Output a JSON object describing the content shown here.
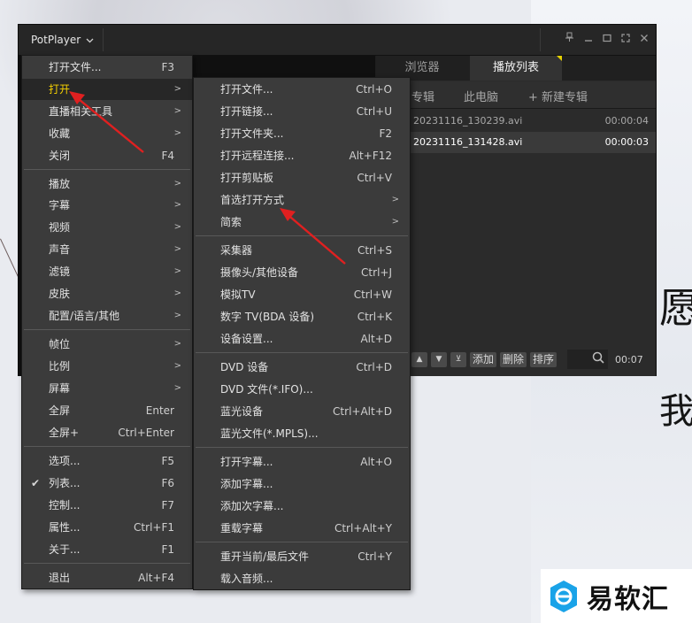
{
  "app": {
    "title": "PotPlayer"
  },
  "titlebar_icons": [
    "pin-icon",
    "minimize-icon",
    "maximize-icon",
    "fullscreen-icon",
    "close-icon"
  ],
  "playlist": {
    "tabs": [
      "浏览器",
      "播放列表"
    ],
    "subtabs": [
      "专辑",
      "此电脑",
      "+ 新建专辑"
    ],
    "items": [
      {
        "name": "20231116_130239.avi",
        "duration": "00:00:04"
      },
      {
        "name": "20231116_131428.avi",
        "duration": "00:00:03"
      }
    ],
    "bottom": {
      "add": "添加",
      "delete": "删除",
      "sort": "排序",
      "time": "00:07"
    }
  },
  "main_menu": {
    "items": [
      {
        "label": "打开文件...",
        "shortcut": "F3"
      },
      {
        "label": "打开",
        "arrow": ">"
      },
      {
        "label": "直播相关工具",
        "arrow": ">"
      },
      {
        "label": "收藏",
        "arrow": ">"
      },
      {
        "label": "关闭",
        "shortcut": "F4"
      },
      {
        "label": "播放",
        "arrow": ">"
      },
      {
        "label": "字幕",
        "arrow": ">"
      },
      {
        "label": "视频",
        "arrow": ">"
      },
      {
        "label": "声音",
        "arrow": ">"
      },
      {
        "label": "滤镜",
        "arrow": ">"
      },
      {
        "label": "皮肤",
        "arrow": ">"
      },
      {
        "label": "配置/语言/其他",
        "arrow": ">"
      },
      {
        "label": "帧位",
        "arrow": ">"
      },
      {
        "label": "比例",
        "arrow": ">"
      },
      {
        "label": "屏幕",
        "arrow": ">"
      },
      {
        "label": "全屏",
        "shortcut": "Enter"
      },
      {
        "label": "全屏+",
        "shortcut": "Ctrl+Enter"
      },
      {
        "label": "选项...",
        "shortcut": "F5"
      },
      {
        "label": "列表...",
        "shortcut": "F6",
        "checked": "✔"
      },
      {
        "label": "控制...",
        "shortcut": "F7"
      },
      {
        "label": "属性...",
        "shortcut": "Ctrl+F1"
      },
      {
        "label": "关于...",
        "shortcut": "F1"
      },
      {
        "label": "退出",
        "shortcut": "Alt+F4"
      }
    ]
  },
  "open_submenu": {
    "items": [
      {
        "label": "打开文件...",
        "shortcut": "Ctrl+O"
      },
      {
        "label": "打开链接...",
        "shortcut": "Ctrl+U"
      },
      {
        "label": "打开文件夹...",
        "shortcut": "F2"
      },
      {
        "label": "打开远程连接...",
        "shortcut": "Alt+F12"
      },
      {
        "label": "打开剪贴板",
        "shortcut": "Ctrl+V"
      },
      {
        "label": "首选打开方式",
        "arrow": ">"
      },
      {
        "label": "简索",
        "arrow": ">"
      },
      {
        "label": "采集器",
        "shortcut": "Ctrl+S"
      },
      {
        "label": "摄像头/其他设备",
        "shortcut": "Ctrl+J"
      },
      {
        "label": "模拟TV",
        "shortcut": "Ctrl+W"
      },
      {
        "label": "数字 TV(BDA 设备)",
        "shortcut": "Ctrl+K"
      },
      {
        "label": "设备设置...",
        "shortcut": "Alt+D"
      },
      {
        "label": "DVD 设备",
        "shortcut": "Ctrl+D"
      },
      {
        "label": "DVD 文件(*.IFO)..."
      },
      {
        "label": "蓝光设备",
        "shortcut": "Ctrl+Alt+D"
      },
      {
        "label": "蓝光文件(*.MPLS)..."
      },
      {
        "label": "打开字幕...",
        "shortcut": "Alt+O"
      },
      {
        "label": "添加字幕..."
      },
      {
        "label": "添加次字幕..."
      },
      {
        "label": "重载字幕",
        "shortcut": "Ctrl+Alt+Y"
      },
      {
        "label": "重开当前/最后文件",
        "shortcut": "Ctrl+Y"
      },
      {
        "label": "载入音频..."
      }
    ]
  },
  "background_text": [
    "愿",
    "我"
  ],
  "watermark": {
    "text": "易软汇"
  },
  "colors": {
    "menu_bg": "#3b3b3b",
    "highlight": "#272727",
    "arrow_red": "#e02020",
    "tab_marker": "#e6d200",
    "logo_blue": "#1aa3e8"
  }
}
